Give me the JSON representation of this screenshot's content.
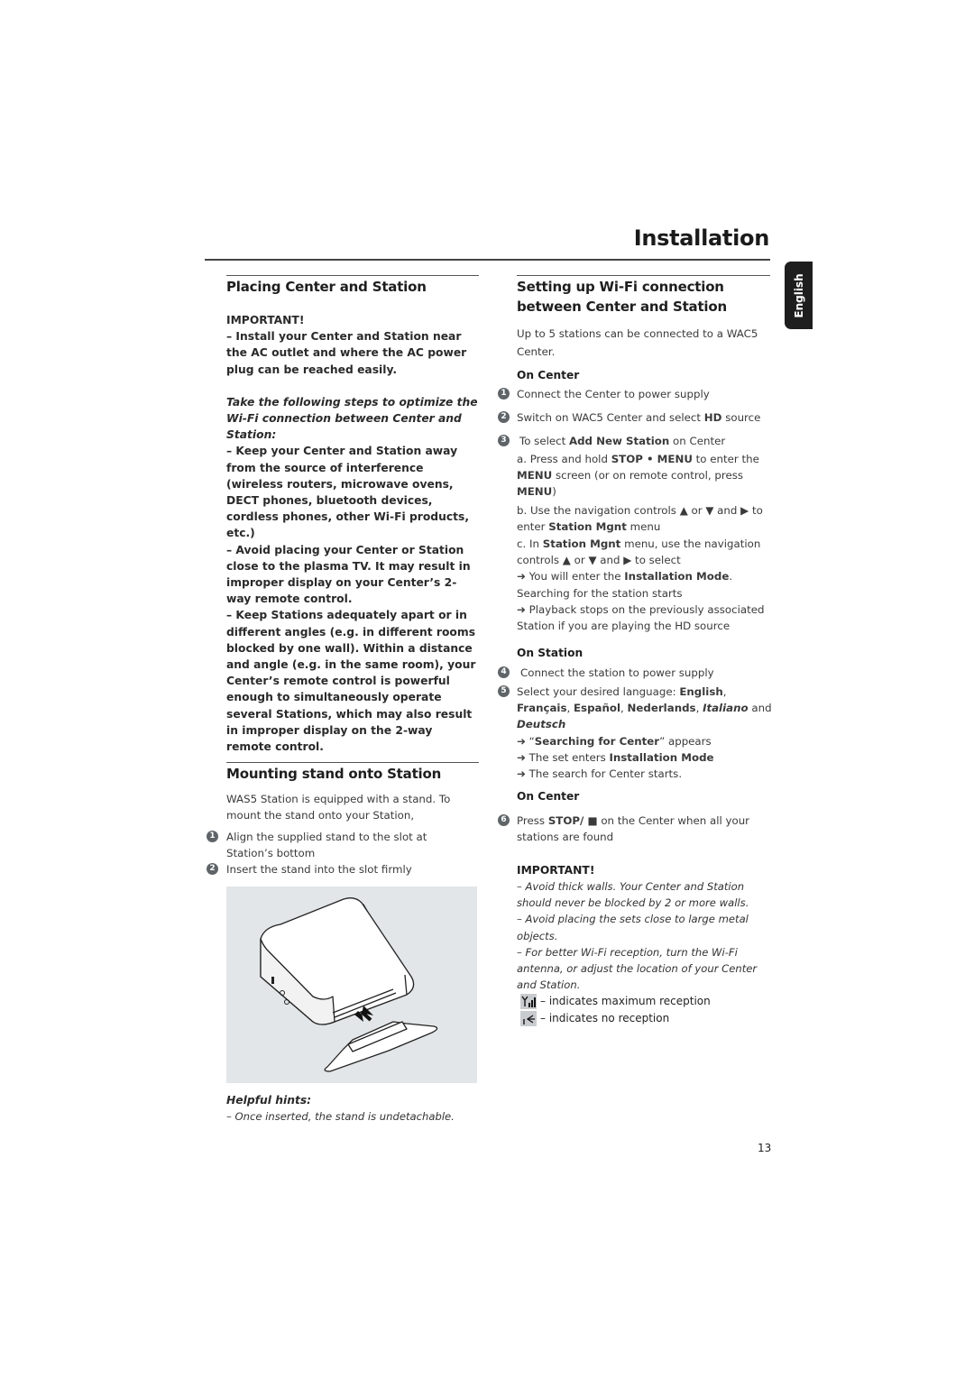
{
  "page": {
    "title": "Installation",
    "language_tab": "English",
    "page_number": "13"
  },
  "left": {
    "placing": {
      "heading": "Placing Center and Station",
      "important_label": "IMPORTANT!",
      "important_text": "–  Install your Center and Station near the AC outlet and where the AC power plug can be reached easily.",
      "steps_intro": "Take the following steps to optimize the Wi-Fi connection between Center and Station:",
      "bullets": [
        "–  Keep your Center and Station away from the source of interference (wireless routers, microwave ovens, DECT phones, bluetooth devices, cordless phones, other Wi-Fi products, etc.)",
        "–  Avoid placing your Center or Station close to the plasma TV.  It may result in improper display on your Center’s 2-way remote control.",
        "–  Keep Stations adequately apart or in different angles (e.g. in different rooms blocked by one wall).  Within a distance and angle (e.g. in the same room), your Center’s remote control is powerful enough to simultaneously operate several Stations, which may also result in improper display on the 2-way remote control."
      ]
    },
    "mounting": {
      "heading": "Mounting stand onto Station",
      "intro": "WAS5 Station is equipped with a stand.  To mount the stand onto your Station,",
      "steps": [
        {
          "num": "1",
          "text": "Align the supplied stand to the slot at Station’s bottom"
        },
        {
          "num": "2",
          "text": "Insert the stand into the slot firmly"
        }
      ],
      "illustration": "station-stand-mounting-illustration",
      "hints_label": "Helpful hints:",
      "hints": [
        "–  Once inserted, the stand is undetachable."
      ]
    }
  },
  "right": {
    "heading": "Setting up  Wi-Fi connection between Center and Station",
    "intro": "Up to 5 stations can be connected to a WAC5 Center.",
    "on_center_label": "On Center",
    "step1": {
      "num": "1",
      "text": "Connect the Center to power supply"
    },
    "step2": {
      "num": "2",
      "pre": "Switch on WAC5 Center and select ",
      "bold": "HD",
      "post": " source"
    },
    "step3": {
      "num": "3",
      "pre": "To select ",
      "bold": "Add New Station",
      "post": " on Center"
    },
    "step3a": {
      "pre": "a. Press and hold ",
      "b1": "STOP • MENU",
      "mid": " to enter the ",
      "b2": "MENU",
      "mid2": " screen (or on remote control, press ",
      "b3": "MENU",
      "post": ")"
    },
    "step3b": {
      "pre": "b. Use the navigation controls ",
      "up": "▲",
      "or": " or ",
      "down": "▼",
      "and": " and ",
      "right": "▶",
      "to": " to enter ",
      "bold": "Station Mgnt",
      "post": " menu"
    },
    "step3c": {
      "pre": "c.  In ",
      "bold": "Station Mgnt",
      "mid": " menu,  use the navigation controls ",
      "up": "▲",
      "or": " or ",
      "down": "▼",
      "and": " and ",
      "right": "▶",
      "post": " to select"
    },
    "result1": {
      "arrow": "➜",
      "pre": " You will enter the ",
      "bold": "Installation Mode",
      "post": ". Searching for the station starts"
    },
    "result2": {
      "arrow": "➜",
      "text": " Playback stops on the previously associated Station if you are playing the HD source"
    },
    "on_station_label": "On Station",
    "step4": {
      "num": "4",
      "text": "Connect the station to power supply"
    },
    "step5": {
      "num": "5",
      "pre": "Select your desired language: ",
      "l1": "English",
      "l2": "Français",
      "l3": "Español",
      "l4": "Nederlands",
      "l5": "Italiano",
      "and": " and ",
      "l6": "Deutsch"
    },
    "result3": {
      "arrow": "➜",
      "pre": " “",
      "bold": "Searching for Center",
      "post": "” appears"
    },
    "result4": {
      "arrow": "➜",
      "pre": " The set enters ",
      "bold": "Installation Mode"
    },
    "result5": {
      "arrow": "➜",
      "text": " The search for Center starts."
    },
    "on_center2_label": "On Center",
    "step6": {
      "num": "6",
      "pre": "Press ",
      "bold": "STOP/ ■",
      "post": "  on the Center when all your stations are found"
    },
    "important_label": "IMPORTANT!",
    "important_items": [
      "–  Avoid thick walls. Your Center and Station should never be blocked by 2 or more walls.",
      "–  Avoid placing the sets close to large metal objects.",
      "–  For better Wi-Fi reception, turn the Wi-Fi antenna, or adjust the location of your Center and Station."
    ],
    "reception": [
      {
        "icon": "signal-max-icon",
        "text": "– indicates maximum reception"
      },
      {
        "icon": "signal-none-icon",
        "text": "– indicates no reception"
      }
    ]
  }
}
